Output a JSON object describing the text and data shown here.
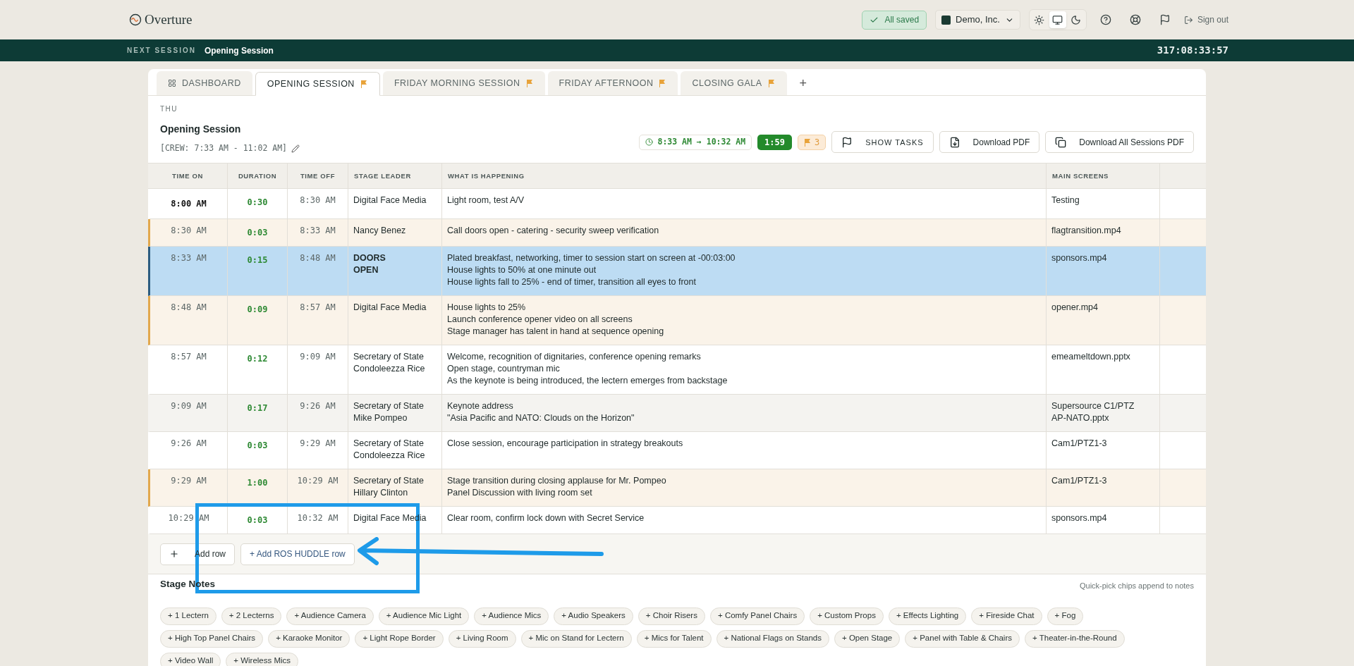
{
  "header": {
    "logo": "Overture",
    "save_status": "All saved",
    "org": "Demo, Inc.",
    "theme_modes": [
      {
        "kind": "light",
        "selected": false
      },
      {
        "kind": "system",
        "selected": true
      },
      {
        "kind": "dark",
        "selected": false
      }
    ],
    "sign_out": "Sign out"
  },
  "next_bar": {
    "label": "NEXT SESSION",
    "session": "Opening Session",
    "countdown": "317:08:33:57"
  },
  "tabs": [
    {
      "label": "DASHBOARD",
      "kind": "dashboard",
      "selected": false,
      "flagged": false
    },
    {
      "label": "OPENING SESSION",
      "kind": "session",
      "selected": true,
      "flagged": true
    },
    {
      "label": "FRIDAY MORNING SESSION",
      "kind": "session",
      "selected": false,
      "flagged": true
    },
    {
      "label": "FRIDAY AFTERNOON",
      "kind": "session",
      "selected": false,
      "flagged": true
    },
    {
      "label": "CLOSING GALA",
      "kind": "session",
      "selected": false,
      "flagged": true
    }
  ],
  "add_tab": "+",
  "session": {
    "day": "THU",
    "title": "Opening Session",
    "crew": "[CREW: 7:33 AM - 11:02 AM]",
    "time_range": "8:33 AM → 10:32 AM",
    "total": "1:59",
    "flag_count": "3",
    "buttons": [
      {
        "label": "SHOW TASKS",
        "kind": "tasks"
      },
      {
        "label": "Download PDF",
        "kind": "pdf"
      },
      {
        "label": "Download All Sessions PDF",
        "kind": "all"
      }
    ]
  },
  "table": {
    "columns": [
      "TIME ON",
      "DURATION",
      "TIME OFF",
      "STAGE LEADER",
      "WHAT IS HAPPENING",
      "MAIN SCREENS"
    ],
    "rows": [
      {
        "time_on": "8:00 AM",
        "duration": "0:30",
        "time_off": "8:30 AM",
        "leader": [
          "Digital Face Media"
        ],
        "happening": [
          "Light room, test A/V"
        ],
        "screens": [
          "Testing"
        ],
        "current": true,
        "flagged": false,
        "selected": false
      },
      {
        "time_on": "8:30 AM",
        "duration": "0:03",
        "time_off": "8:33 AM",
        "leader": [
          "Nancy Benez"
        ],
        "happening": [
          "Call doors open - catering - security sweep verification"
        ],
        "screens": [
          "flagtransition.mp4"
        ],
        "current": false,
        "flagged": true,
        "selected": false
      },
      {
        "time_on": "8:33 AM",
        "duration": "0:15",
        "time_off": "8:48 AM",
        "leader": [
          "DOORS",
          "OPEN"
        ],
        "leader_bold": true,
        "happening": [
          "Plated breakfast, networking, timer to session start on screen at -00:03:00",
          "House lights to 50% at one minute out",
          "House lights fall to 25% - end of timer, transition all eyes to front"
        ],
        "screens": [
          "sponsors.mp4"
        ],
        "current": false,
        "flagged": false,
        "selected": true
      },
      {
        "time_on": "8:48 AM",
        "duration": "0:09",
        "time_off": "8:57 AM",
        "leader": [
          "Digital Face Media"
        ],
        "happening": [
          "House lights to 25%",
          "Launch conference opener video on all screens",
          "Stage manager has talent in hand at sequence opening"
        ],
        "screens": [
          "opener.mp4"
        ],
        "current": false,
        "flagged": true,
        "selected": false
      },
      {
        "time_on": "8:57 AM",
        "duration": "0:12",
        "time_off": "9:09 AM",
        "leader": [
          "Secretary of State",
          "Condoleezza Rice"
        ],
        "happening": [
          "Welcome, recognition of dignitaries, conference opening remarks",
          "Open stage, countryman mic",
          "As the keynote is being introduced, the lectern emerges from backstage"
        ],
        "screens": [
          "emeameltdown.pptx"
        ],
        "current": false,
        "flagged": false,
        "selected": false
      },
      {
        "time_on": "9:09 AM",
        "duration": "0:17",
        "time_off": "9:26 AM",
        "leader": [
          "Secretary of State",
          "Mike Pompeo"
        ],
        "happening": [
          "Keynote address",
          "\"Asia Pacific and NATO: Clouds on the Horizon\""
        ],
        "screens": [
          "Supersource C1/PTZ",
          "AP-NATO.pptx"
        ],
        "current": false,
        "flagged": false,
        "selected": false
      },
      {
        "time_on": "9:26 AM",
        "duration": "0:03",
        "time_off": "9:29 AM",
        "leader": [
          "Secretary of State",
          "Condoleezza Rice"
        ],
        "happening": [
          "Close session, encourage participation in strategy breakouts"
        ],
        "screens": [
          "Cam1/PTZ1-3"
        ],
        "current": false,
        "flagged": false,
        "selected": false
      },
      {
        "time_on": "9:29 AM",
        "duration": "1:00",
        "time_off": "10:29 AM",
        "leader": [
          "Secretary of State",
          "Hillary Clinton"
        ],
        "happening": [
          "Stage transition during closing applause for Mr. Pompeo",
          "Panel Discussion with living room set"
        ],
        "screens": [
          "Cam1/PTZ1-3"
        ],
        "current": false,
        "flagged": true,
        "selected": false
      },
      {
        "time_on": "10:29 AM",
        "duration": "0:03",
        "time_off": "10:32 AM",
        "leader": [
          "Digital Face Media"
        ],
        "happening": [
          "Clear room, confirm lock down with Secret Service"
        ],
        "screens": [
          "sponsors.mp4"
        ],
        "current": false,
        "flagged": false,
        "selected": false
      }
    ]
  },
  "actions": {
    "add_row": "Add row",
    "add_huddle": "+ Add ROS HUDDLE row"
  },
  "stage_notes": {
    "title": "Stage Notes",
    "hint": "Quick-pick chips append to notes",
    "chips": [
      "+ 1 Lectern",
      "+ 2 Lecterns",
      "+ Audience Camera",
      "+ Audience Mic Light",
      "+ Audience Mics",
      "+ Audio Speakers",
      "+ Choir Risers",
      "+ Comfy Panel Chairs",
      "+ Custom Props",
      "+ Effects Lighting",
      "+ Fireside Chat",
      "+ Fog",
      "+ High Top Panel Chairs",
      "+ Karaoke Monitor",
      "+ Light Rope Border",
      "+ Living Room",
      "+ Mic on Stand for Lectern",
      "+ Mics for Talent",
      "+ National Flags on Stands",
      "+ Open Stage",
      "+ Panel with Table & Chairs",
      "+ Theater-in-the-Round",
      "+ Video Wall",
      "+ Wireless Mics"
    ]
  }
}
